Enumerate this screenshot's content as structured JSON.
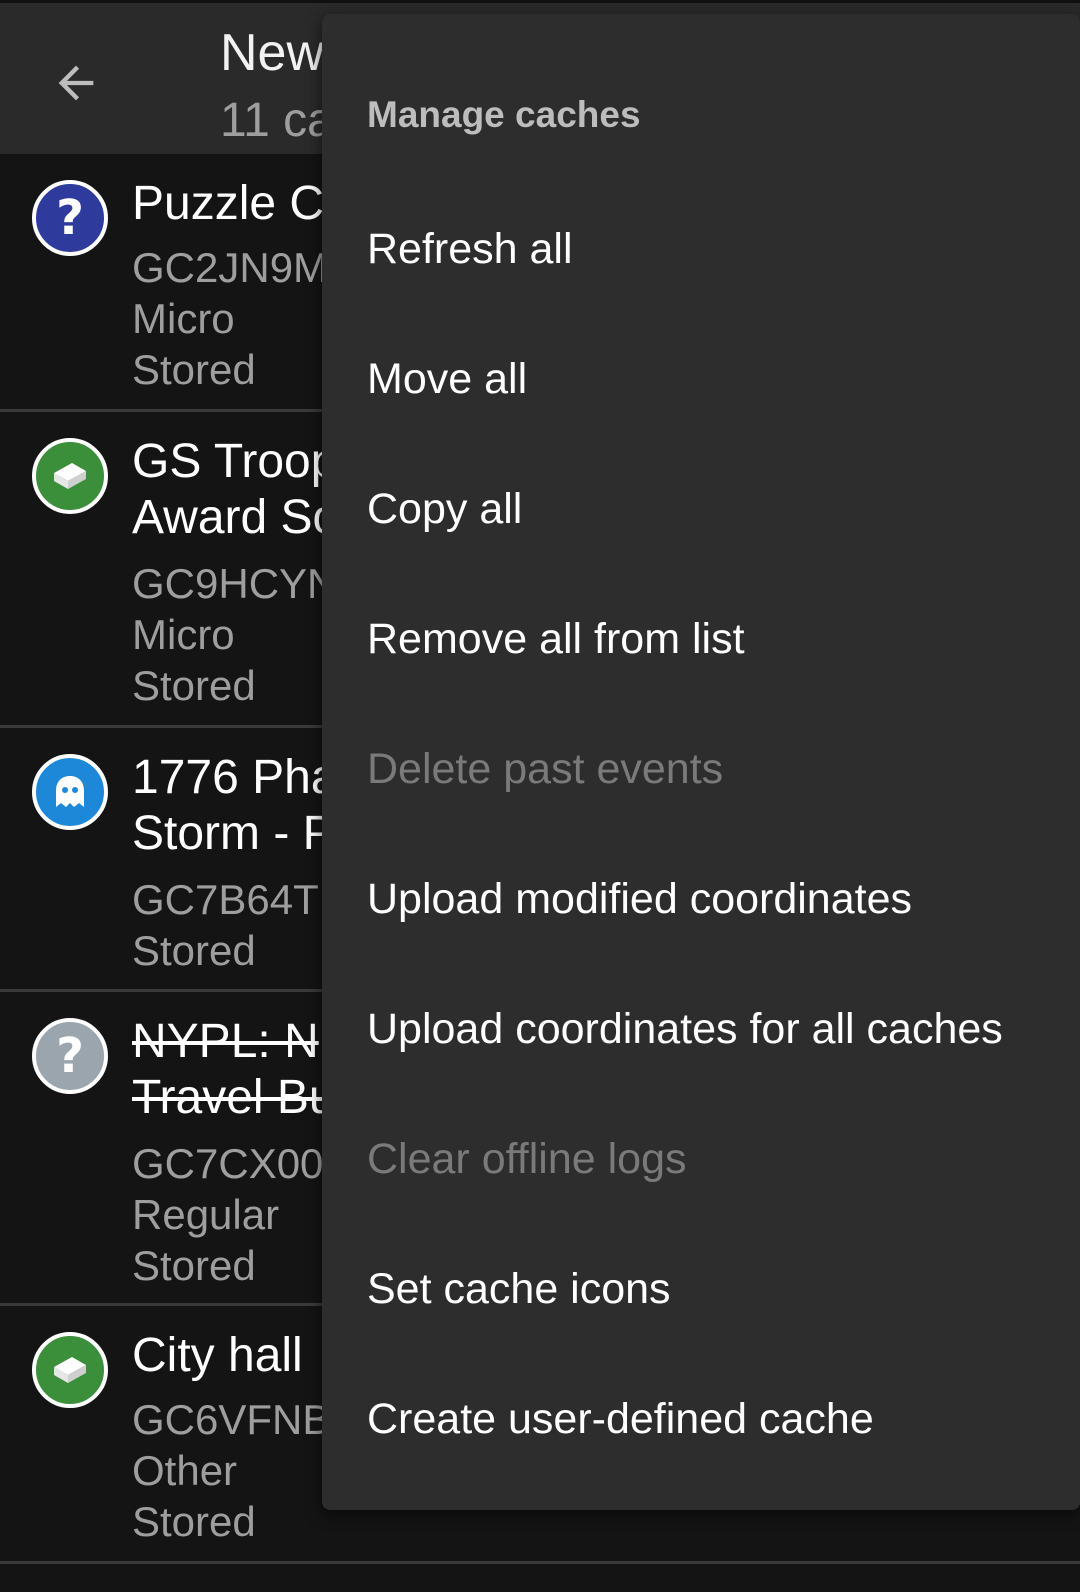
{
  "toolbar": {
    "title": "New",
    "subtitle": "11 ca"
  },
  "caches": [
    {
      "name": "Puzzle C",
      "code": "GC2JN9M",
      "size": "Micro",
      "status": "Stored",
      "icon": "puzzle-icon",
      "icon_color": "#2f3b9c",
      "archived": false
    },
    {
      "name": "GS Troop\nAward So",
      "code": "GC9HCYN",
      "size": "Micro",
      "status": "Stored",
      "icon": "traditional-icon",
      "icon_color": "#3b8f3a",
      "archived": false
    },
    {
      "name": "1776 Pha\nStorm - P",
      "code": "GC7B64T",
      "size": "",
      "status": "Stored",
      "icon": "ghost-icon",
      "icon_color": "#1e88d8",
      "archived": false
    },
    {
      "name": "NYPL: N\nTravel Bu",
      "code": "GC7CX00",
      "size": "Regular",
      "status": "Stored",
      "icon": "puzzle-icon",
      "icon_color": "#9aa5ad",
      "archived": true
    },
    {
      "name": "City hall",
      "code": "GC6VFNB",
      "size": "Other",
      "status": "Stored",
      "icon": "traditional-icon",
      "icon_color": "#3b8f3a",
      "archived": false
    }
  ],
  "menu": {
    "header": "Manage caches",
    "items": [
      {
        "label": "Refresh all",
        "enabled": true
      },
      {
        "label": "Move all",
        "enabled": true
      },
      {
        "label": "Copy all",
        "enabled": true
      },
      {
        "label": "Remove all from list",
        "enabled": true
      },
      {
        "label": "Delete past events",
        "enabled": false
      },
      {
        "label": "Upload modified coordinates",
        "enabled": true
      },
      {
        "label": "Upload coordinates for all caches",
        "enabled": true
      },
      {
        "label": "Clear offline logs",
        "enabled": false
      },
      {
        "label": "Set cache icons",
        "enabled": true
      },
      {
        "label": "Create user-defined cache",
        "enabled": true
      }
    ]
  }
}
